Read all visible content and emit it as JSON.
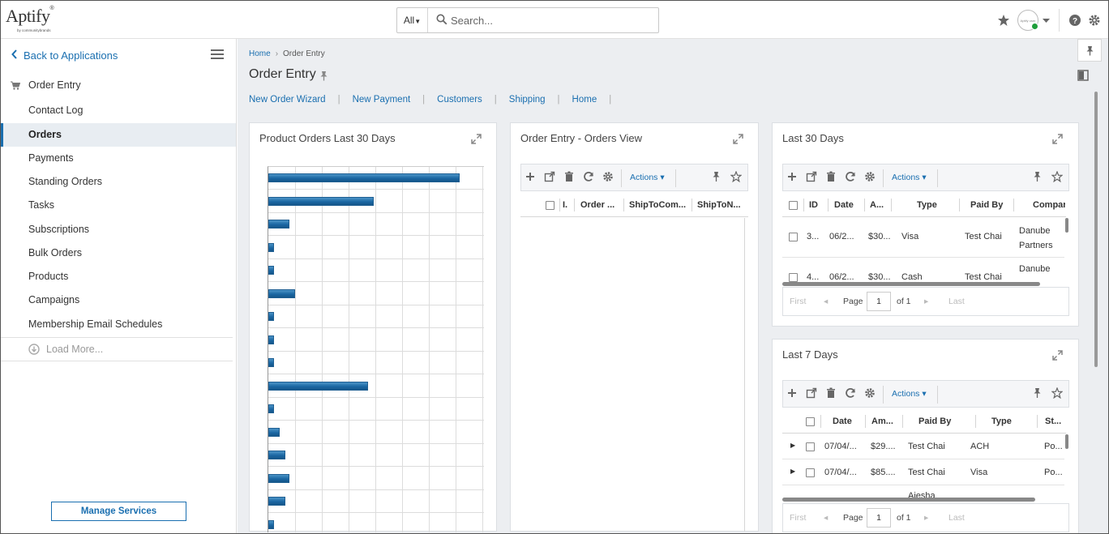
{
  "header": {
    "logo_text": "Aptify",
    "logo_sub": "by communitybrands",
    "search_scope": "All",
    "search_placeholder": "Search...",
    "avatar_text": "Aptify user"
  },
  "sidebar": {
    "back_label": "Back to Applications",
    "section_label": "Order Entry",
    "items": [
      {
        "label": "Contact Log"
      },
      {
        "label": "Orders"
      },
      {
        "label": "Payments"
      },
      {
        "label": "Standing Orders"
      },
      {
        "label": "Tasks"
      },
      {
        "label": "Subscriptions"
      },
      {
        "label": "Bulk Orders"
      },
      {
        "label": "Products"
      },
      {
        "label": "Campaigns"
      },
      {
        "label": "Membership Email Schedules"
      }
    ],
    "active_item": "Orders",
    "load_more": "Load More...",
    "manage_services": "Manage Services"
  },
  "breadcrumb": {
    "home": "Home",
    "current": "Order Entry"
  },
  "page_title": "Order Entry",
  "quick_links": [
    "New Order Wizard",
    "New Payment",
    "Customers",
    "Shipping",
    "Home"
  ],
  "cards": {
    "product_orders": {
      "title": "Product Orders Last 30 Days"
    },
    "orders_view": {
      "title": "Order Entry - Orders View",
      "actions": "Actions",
      "columns": [
        "I.",
        "Order ...",
        "ShipToCom...",
        "ShipToN..."
      ]
    },
    "last30": {
      "title": "Last 30 Days",
      "actions": "Actions",
      "columns": [
        "ID",
        "Date",
        "A...",
        "Type",
        "Paid By",
        "Compar"
      ],
      "rows": [
        {
          "id": "3...",
          "date": "06/2...",
          "amount": "$30...",
          "type": "Visa",
          "paid_by": "Test Chai",
          "company": "Danube Partners"
        },
        {
          "id": "4...",
          "date": "06/2...",
          "amount": "$30...",
          "type": "Cash",
          "paid_by": "Test Chai",
          "company": "Danube"
        }
      ],
      "pager": {
        "first": "First",
        "page_label": "Page",
        "page": "1",
        "of": "of 1",
        "last": "Last"
      }
    },
    "last7": {
      "title": "Last 7 Days",
      "actions": "Actions",
      "columns": [
        "Date",
        "Am...",
        "Paid By",
        "Type",
        "St..."
      ],
      "rows": [
        {
          "date": "07/04/...",
          "amount": "$29....",
          "paid_by": "Test Chai",
          "type": "ACH",
          "status": "Po..."
        },
        {
          "date": "07/04/...",
          "amount": "$85....",
          "paid_by": "Test Chai",
          "type": "Visa",
          "status": "Po..."
        },
        {
          "date": "",
          "amount": "",
          "paid_by": "Ajesha",
          "type": "",
          "status": ""
        }
      ],
      "pager": {
        "first": "First",
        "page_label": "Page",
        "page": "1",
        "of": "of 1",
        "last": "Last"
      }
    }
  },
  "chart_data": {
    "type": "bar",
    "orientation": "horizontal",
    "categories": [],
    "values": [
      100,
      55,
      11,
      3,
      3,
      14,
      3,
      3,
      3,
      52,
      3,
      6,
      9,
      11,
      9,
      3
    ],
    "xlim": [
      0,
      112
    ],
    "grid": true,
    "bar_color": "#1b67a3"
  },
  "colors": {
    "accent": "#1a6fb0",
    "status_online": "#1e9e3a"
  }
}
